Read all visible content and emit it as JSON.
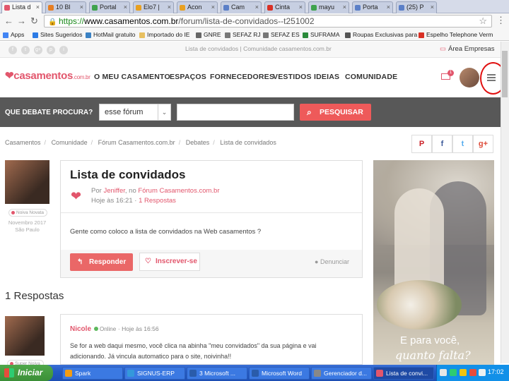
{
  "browser": {
    "tabs": [
      {
        "label": "Lista d",
        "color": "#e2566c",
        "active": true
      },
      {
        "label": "10 Bl",
        "color": "#e67e22"
      },
      {
        "label": "Portal",
        "color": "#3fa34d"
      },
      {
        "label": "Elo7 |",
        "color": "#e8a020"
      },
      {
        "label": "Acon",
        "color": "#e8a020"
      },
      {
        "label": "Cam",
        "color": "#5b7fc7"
      },
      {
        "label": "Cinta",
        "color": "#d93025"
      },
      {
        "label": "mayu",
        "color": "#3fa34d"
      },
      {
        "label": "Porta",
        "color": "#5b7fc7"
      },
      {
        "label": "(25) P",
        "color": "#5b7fc7"
      }
    ],
    "url_scheme": "https://",
    "url_host": "www.casamentos.com.br",
    "url_path": "/forum/lista-de-convidados--t251002",
    "bookmarks": [
      {
        "label": "Apps",
        "color": "#4285f4"
      },
      {
        "label": "Sites Sugeridos",
        "color": "#2c7be5"
      },
      {
        "label": "HotMail gratuito",
        "color": "#3b82c4"
      },
      {
        "label": "Importado do IE",
        "color": "#e8c060"
      },
      {
        "label": "GNRE",
        "color": "#666"
      },
      {
        "label": "SEFAZ RJ",
        "color": "#777"
      },
      {
        "label": "SEFAZ ES",
        "color": "#777"
      },
      {
        "label": "SUFRAMA",
        "color": "#2a8a3a"
      },
      {
        "label": "Roupas Exclusivas para",
        "color": "#555"
      },
      {
        "label": "Espelho Telephone Verm",
        "color": "#d93025"
      }
    ]
  },
  "site": {
    "top_breadcrumb": "Lista de convidados | Comunidade casamentos.com.br",
    "area_empresas": "Área Empresas",
    "logo": "casamentos",
    "logo_suffix": ".com.br",
    "nav": [
      "O MEU CASAMENTO",
      "ESPAÇOS",
      "FORNECEDORES",
      "VESTIDOS",
      "IDEIAS",
      "COMUNIDADE"
    ],
    "mail_count": "1",
    "search_label": "QUE DEBATE PROCURA?",
    "search_select": "esse fórum",
    "search_button": "PESQUISAR",
    "social": [
      "f",
      "t",
      "g+",
      "p",
      "i"
    ]
  },
  "breadcrumbs": [
    "Casamentos",
    "Comunidade",
    "Fórum Casamentos.com.br",
    "Debates",
    "Lista de convidados"
  ],
  "share": {
    "pinterest": "P",
    "facebook": "f",
    "twitter": "t",
    "googleplus": "g+"
  },
  "post": {
    "title": "Lista de convidados",
    "by": "Por",
    "author": "Jeniffer",
    "in": ", no",
    "forum": "Fórum Casamentos.com.br",
    "time": "Hoje às 16:21",
    "replies_link": "1 Respostas",
    "body": "Gente como coloco a lista de convidados na Web casamentos ?",
    "reply_button": "Responder",
    "subscribe_button": "Inscrever-se",
    "report": "Denunciar",
    "user_badge": "Noiva Novata",
    "user_since": "Novembro 2017",
    "user_city": "São Paulo"
  },
  "responses": {
    "heading": "1 Respostas",
    "items": [
      {
        "name": "Nicole",
        "status": "Online",
        "time": "Hoje às 16:56",
        "badge": "Super Noiva",
        "line1": "Se for a web daqui mesmo, você clica na abinha \"meu convidados\" da sua página e vai",
        "line2": "adicionando. Já vincula automatico para o site, noivinha!!"
      }
    ]
  },
  "ad": {
    "line1": "E para você,",
    "line2": "quanto falta?"
  },
  "taskbar": {
    "start": "Iniciar",
    "items": [
      {
        "label": "Spark",
        "color": "#f39c12"
      },
      {
        "label": "SIGNUS-ERP",
        "color": "#3498db"
      },
      {
        "label": "3 Microsoft ...",
        "color": "#2a5caa"
      },
      {
        "label": "Microsoft Word",
        "color": "#2a5caa"
      },
      {
        "label": "Gerenciador d...",
        "color": "#888"
      },
      {
        "label": "Lista de convi...",
        "color": "#e2566c",
        "active": true
      }
    ],
    "clock": "17:02"
  }
}
